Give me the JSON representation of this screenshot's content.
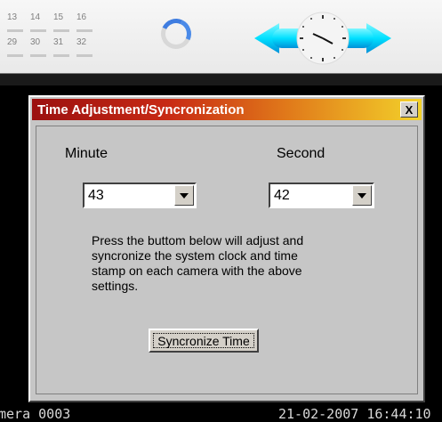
{
  "top_strip": {
    "numbers_row1": [
      "13",
      "14",
      "15",
      "16"
    ],
    "numbers_row2": [
      "29",
      "30",
      "31",
      "32"
    ],
    "spinner_icon": "loading-ring-icon",
    "clock_icon": "world-clock-icon"
  },
  "dialog": {
    "title": "Time Adjustment/Syncronization",
    "close_label": "X",
    "minute_label": "Minute",
    "second_label": "Second",
    "minute_value": "43",
    "second_value": "42",
    "description": "Press the buttom below will adjust and syncronize the system clock and time stamp on each camera with the above settings.",
    "sync_button": "Syncronize Time"
  },
  "osd": {
    "camera_text": "mera 0003",
    "timestamp": "21-02-2007 16:44:10"
  },
  "colors": {
    "titlebar_start": "#9b1010",
    "titlebar_end": "#f3d22a",
    "dialog_bg": "#c6c6c6",
    "clock_band": "#00e0ff",
    "spinner_accent": "#3f7de0"
  }
}
